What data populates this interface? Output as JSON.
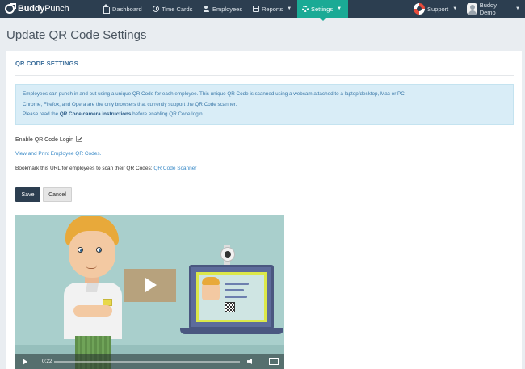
{
  "brand": {
    "name_bold": "Buddy",
    "name_thin": "Punch"
  },
  "nav": {
    "items": [
      {
        "label": "Dashboard",
        "icon": "home-icon"
      },
      {
        "label": "Time Cards",
        "icon": "clock-icon"
      },
      {
        "label": "Employees",
        "icon": "users-icon"
      },
      {
        "label": "Reports",
        "icon": "reports-icon"
      },
      {
        "label": "Settings",
        "icon": "gear-icon"
      }
    ],
    "support_label": "Support",
    "user_label": "Buddy Demo",
    "active_color": "#1aaa95",
    "bar_color": "#2c3e50"
  },
  "page": {
    "title": "Update QR Code Settings"
  },
  "panel": {
    "title": "QR CODE SETTINGS",
    "info": {
      "line1": "Employees can punch in and out using a unique QR Code for each employee. This unique QR Code is scanned using a webcam attached to a laptop/desktop, Mac or PC.",
      "line2": "Chrome, Firefox, and Opera are the only browsers that currently support the QR Code scanner.",
      "line3_prefix": "Please read the ",
      "line3_bold": "QR Code camera instructions",
      "line3_suffix": " before enabling QR Code login."
    },
    "enable_label": "Enable QR Code Login",
    "enable_checked": true,
    "view_print_link": "View and Print Employee QR Codes.",
    "bookmark_text": "Bookmark this URL for employees to scan their QR Codes: ",
    "bookmark_link": "QR Code Scanner",
    "save_label": "Save",
    "cancel_label": "Cancel"
  },
  "video": {
    "time": "0:22",
    "progress": 0.0
  }
}
